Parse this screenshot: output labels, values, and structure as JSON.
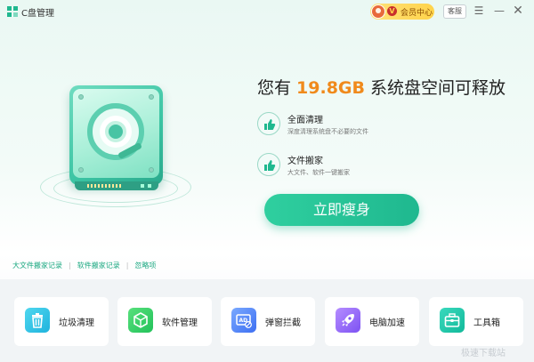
{
  "app": {
    "title": "C盘管理",
    "logo_icon": "c-drive-logo-icon"
  },
  "titlebar": {
    "vip_badge": "V",
    "vip_label": "会员中心",
    "service_label": "客服",
    "menu_icon": "menu-icon",
    "minimize_icon": "minimize-icon",
    "close_icon": "close-icon"
  },
  "headline": {
    "prefix": "您有 ",
    "size": "19.8GB",
    "suffix": " 系统盘空间可释放"
  },
  "features": [
    {
      "title": "全面清理",
      "desc": "深度清理系统盘不必要的文件",
      "icon": "thumbs-up-icon"
    },
    {
      "title": "文件搬家",
      "desc": "大文件、软件一键搬家",
      "icon": "thumbs-up-icon"
    }
  ],
  "primary_button": "立即瘦身",
  "links": [
    "大文件搬家记录",
    "软件搬家记录",
    "忽略项"
  ],
  "tools": [
    {
      "label": "垃圾清理",
      "icon": "trash-icon"
    },
    {
      "label": "软件管理",
      "icon": "cube-icon"
    },
    {
      "label": "弹窗拦截",
      "icon": "ad-block-icon"
    },
    {
      "label": "电脑加速",
      "icon": "rocket-icon"
    },
    {
      "label": "工具箱",
      "icon": "toolbox-icon"
    }
  ],
  "colors": {
    "accent": "#1fb88f",
    "highlight": "#f08a1c",
    "vip": "#ffd34a"
  },
  "watermark": "极速下载站"
}
